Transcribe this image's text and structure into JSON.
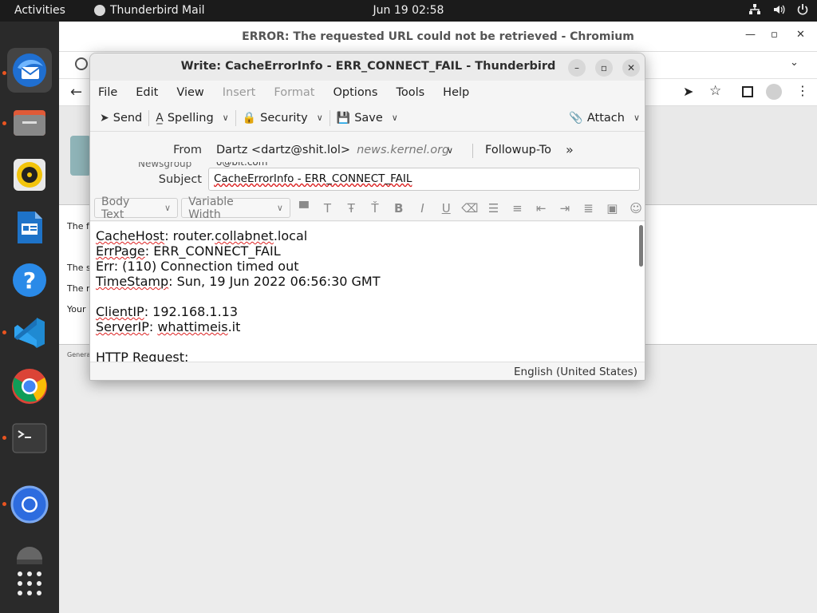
{
  "topbar": {
    "activities": "Activities",
    "app_name": "Thunderbird Mail",
    "clock": "Jun 19  02:58"
  },
  "dock": {
    "items": [
      "thunderbird",
      "files",
      "rhythmbox",
      "libreoffice-writer",
      "help",
      "vscode",
      "chrome",
      "terminal",
      "chromium",
      "disk",
      "show-apps"
    ]
  },
  "chromium": {
    "window_title": "ERROR: The requested URL could not be retrieved - Chromium",
    "page_snippets": [
      "The f",
      "The s",
      "The r",
      "Your"
    ],
    "footer": "Genera"
  },
  "compose": {
    "window_title": "Write: CacheErrorInfo - ERR_CONNECT_FAIL - Thunderbird",
    "menu": [
      {
        "label": "File",
        "enabled": true
      },
      {
        "label": "Edit",
        "enabled": true
      },
      {
        "label": "View",
        "enabled": true
      },
      {
        "label": "Insert",
        "enabled": false
      },
      {
        "label": "Format",
        "enabled": false
      },
      {
        "label": "Options",
        "enabled": true
      },
      {
        "label": "Tools",
        "enabled": true
      },
      {
        "label": "Help",
        "enabled": true
      }
    ],
    "toolbar": {
      "send": "Send",
      "spelling": "Spelling",
      "security": "Security",
      "save": "Save",
      "attach": "Attach"
    },
    "headers": {
      "from_label": "From",
      "from_value": "Dartz <dartz@shit.lol>",
      "from_account": "news.kernel.org",
      "followup_to": "Followup-To",
      "newsgroup_label": "Newsgroup",
      "newsgroup_value": "o@bit.com",
      "subject_label": "Subject",
      "subject_value": "CacheErrorInfo - ERR_CONNECT_FAIL"
    },
    "format": {
      "paragraph": "Body Text",
      "font": "Variable Width"
    },
    "body_lines": {
      "l1a": "CacheHost",
      "l1b": ": router.",
      "l1c": "collabnet",
      "l1d": ".local",
      "l2a": "ErrPage",
      "l2b": ": ERR_CONNECT_FAIL",
      "l3": "Err: (110) Connection timed out",
      "l4a": "TimeStamp",
      "l4b": ": Sun, 19 Jun 2022 06:56:30 GMT",
      "l5a": "ClientIP",
      "l5b": ": 192.168.1.13",
      "l6a": "ServerIP",
      "l6b": ": ",
      "l6c": "whattimeis",
      "l6d": ".it",
      "l7": "HTTP Request:"
    },
    "status_language": "English (United States)"
  }
}
